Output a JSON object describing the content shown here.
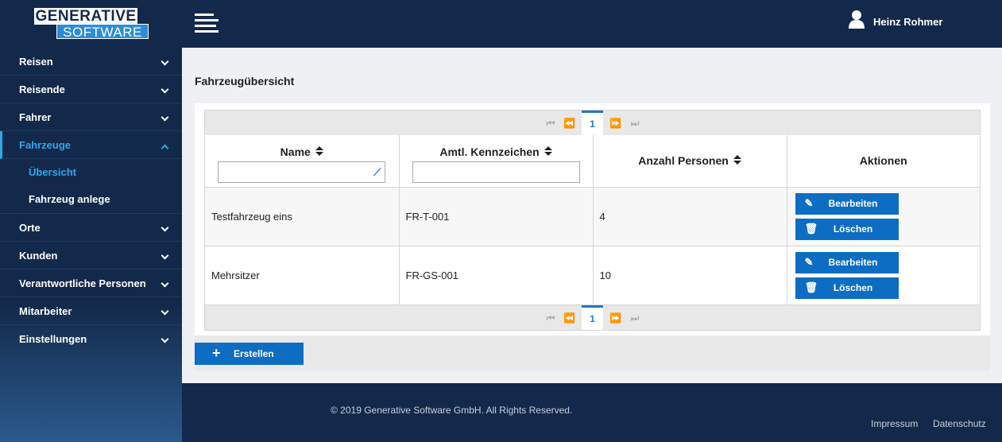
{
  "header": {
    "logo_line1": "GENERATIVE",
    "logo_line2": "SOFTWARE",
    "menu_icon": "hamburger-icon",
    "user_icon": "user-icon",
    "user_name": "Heinz Rohmer"
  },
  "sidebar": {
    "items": [
      {
        "label": "Reisen"
      },
      {
        "label": "Reisende"
      },
      {
        "label": "Fahrer"
      },
      {
        "label": "Fahrzeuge",
        "active": true
      },
      {
        "label": "Orte"
      },
      {
        "label": "Kunden"
      },
      {
        "label": "Verantwortliche Personen"
      },
      {
        "label": "Mitarbeiter"
      },
      {
        "label": "Einstellungen"
      }
    ],
    "sub_items": [
      {
        "label": "Übersicht",
        "current": true
      },
      {
        "label": "Fahrzeug anlege"
      }
    ]
  },
  "main": {
    "title": "Fahrzeugübersicht",
    "paginator": {
      "current_page": "1"
    },
    "columns": [
      "Name",
      "Amtl. Kennzeichen",
      "Anzahl Personen",
      "Aktionen"
    ],
    "filters": {
      "name": "",
      "kennzeichen": ""
    },
    "rows": [
      {
        "name": "Testfahrzeug eins",
        "kennzeichen": "FR-T-001",
        "personen": "4"
      },
      {
        "name": "Mehrsitzer",
        "kennzeichen": "FR-GS-001",
        "personen": "10"
      }
    ],
    "actions": {
      "edit_label": "Bearbeiten",
      "delete_label": "Löschen"
    },
    "create_label": "Erstellen"
  },
  "footer": {
    "copyright": "© 2019 Generative Software GmbH. All Rights Reserved.",
    "impressum": "Impressum",
    "datenschutz": "Datenschutz"
  },
  "colors": {
    "header_bg": "#13294b",
    "accent": "#2fa8e8",
    "button": "#0c6dc2"
  }
}
